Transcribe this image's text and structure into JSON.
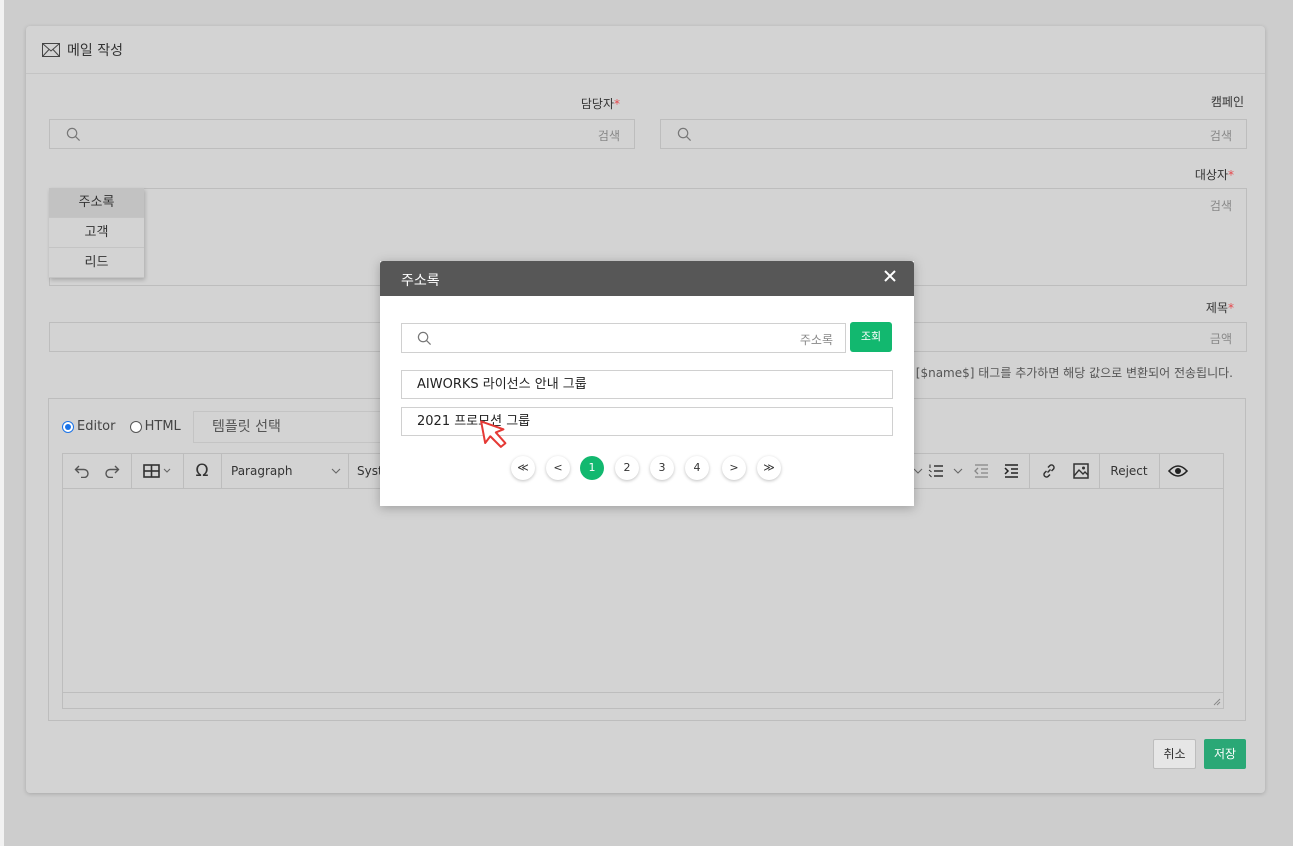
{
  "header": {
    "title": "메일 작성",
    "icon": "envelope-icon"
  },
  "form": {
    "owner_label": "담당자",
    "campaign_label": "캠페인",
    "recipient_label": "대상자",
    "subject_label": "제목",
    "required_mark": "*",
    "owner_placeholder": "검색",
    "campaign_placeholder": "검색",
    "recipient_placeholder": "검색",
    "subject_placeholder": "금액",
    "hint": "[$name$] 태그를 추가하면 해당 값으로 변환되어 전송됩니다."
  },
  "recipient_dropdown": [
    "주소록",
    "고객",
    "리드"
  ],
  "editor": {
    "mode_editor": "Editor",
    "mode_html": "HTML",
    "template_placeholder": "템플릿 선택",
    "paragraph": "Paragraph",
    "font_partial": "Syst",
    "reject": "Reject"
  },
  "buttons": {
    "cancel": "취소",
    "save": "저장"
  },
  "modal": {
    "title": "주소록",
    "search_placeholder": "주소록",
    "search_button": "조회",
    "items": [
      "AIWORKS 라이선스 안내 그룹",
      "2021 프로모션 그룹"
    ],
    "pagination": {
      "first": "≪",
      "prev": "<",
      "pages": [
        "1",
        "2",
        "3",
        "4"
      ],
      "current": "1",
      "next": ">",
      "last": "≫"
    }
  },
  "colors": {
    "accent": "#12b86f",
    "save": "#2aa876",
    "modal_header": "#575757",
    "required": "#e5484d"
  }
}
